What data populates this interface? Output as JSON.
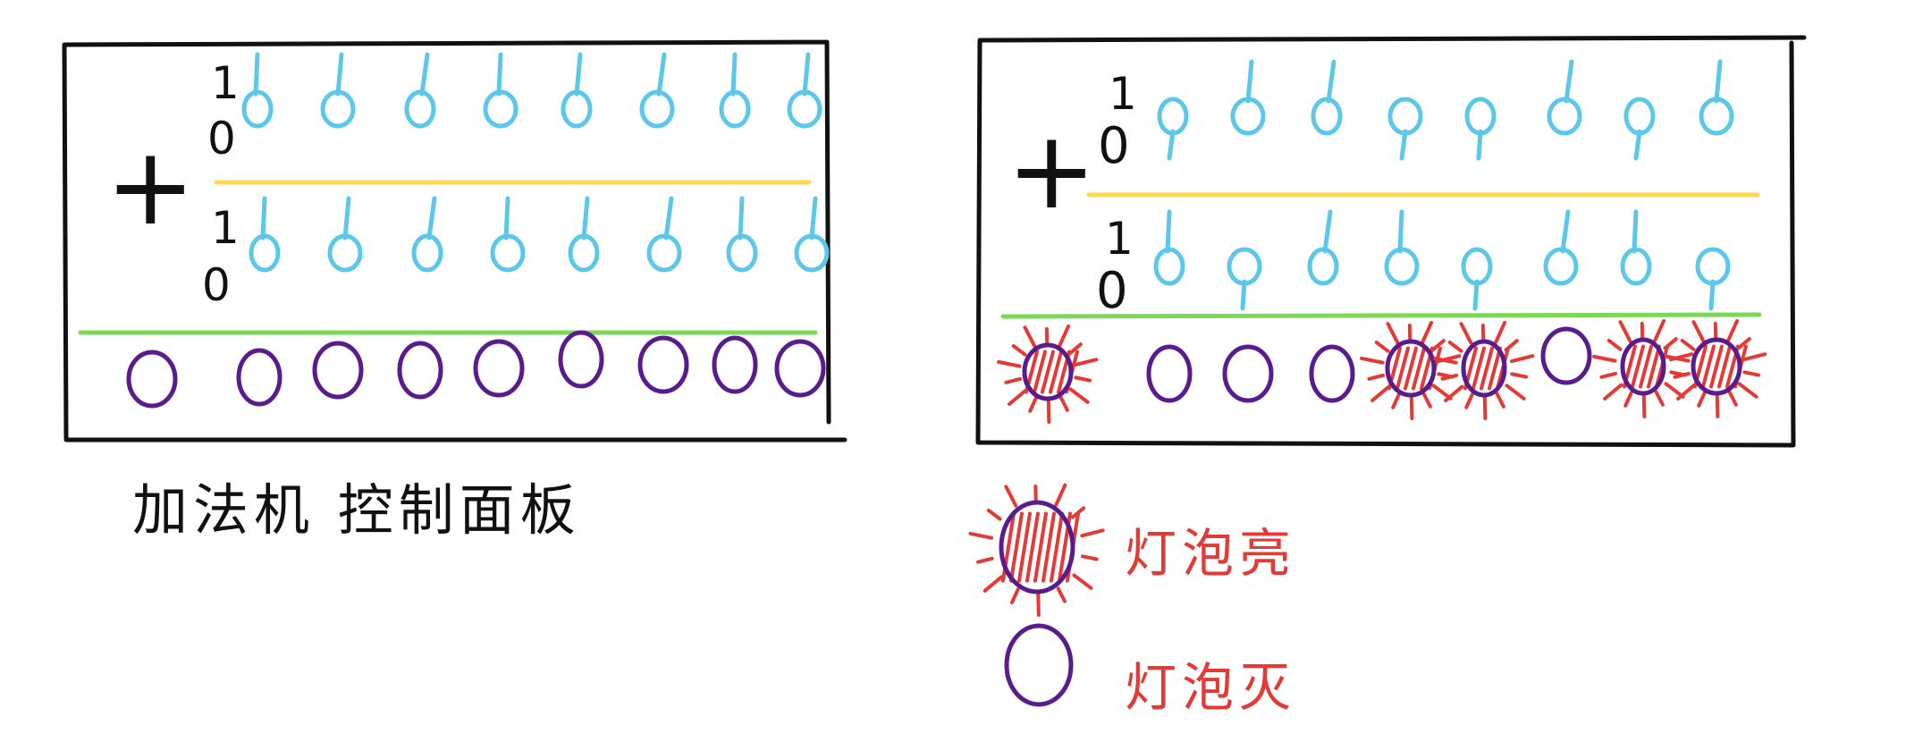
{
  "colors": {
    "frame": "#111111",
    "switch": "#5bc8ea",
    "divider_operands": "#ffd84d",
    "divider_result": "#7cd957",
    "lamp": "#5a1b8c",
    "lit": "#e53935",
    "text": "#111111",
    "legend_text": "#e53935"
  },
  "left_panel": {
    "caption": "加法机 控制面板",
    "operator": "+",
    "scale_one": "1",
    "scale_zero": "0",
    "row_a": [
      1,
      1,
      1,
      1,
      1,
      1,
      1,
      1
    ],
    "row_b": [
      1,
      1,
      1,
      1,
      1,
      1,
      1,
      1
    ],
    "lamps": [
      0,
      0,
      0,
      0,
      0,
      0,
      0,
      0,
      0
    ]
  },
  "right_panel": {
    "operator": "+",
    "scale_one": "1",
    "scale_zero": "0",
    "row_a": [
      0,
      1,
      1,
      0,
      0,
      1,
      0,
      1
    ],
    "row_b": [
      1,
      0,
      1,
      1,
      0,
      1,
      1,
      0
    ],
    "lamps": [
      1,
      0,
      0,
      0,
      1,
      1,
      0,
      1,
      1
    ]
  },
  "legend": {
    "on_label": "灯泡亮",
    "off_label": "灯泡灭"
  }
}
